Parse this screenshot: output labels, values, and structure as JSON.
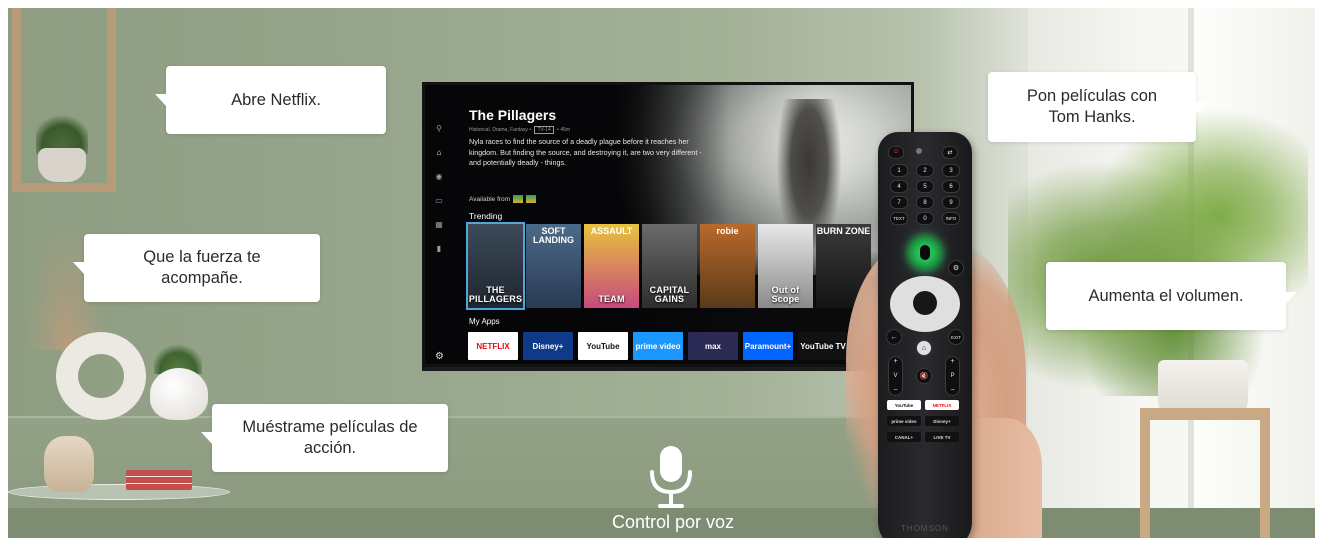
{
  "bubbles": {
    "netflix": "Abre Netflix.",
    "force": "Que la fuerza te acompañe.",
    "action": "Muéstrame películas de acción.",
    "hanks": "Pon películas con Tom Hanks.",
    "volume": "Aumenta el volumen."
  },
  "caption": "Control por voz",
  "tv": {
    "title": "The Pillagers",
    "meta": "Historical, Drama, Fantasy",
    "rating": "TV-14",
    "duration": "45m",
    "description": "Nyla races to find the source of a deadly plague before it reaches her kingdom. But finding the source, and destroying it, are two very different - and potentially deadly - things.",
    "available_from": "Available from",
    "trending_label": "Trending",
    "myapps_label": "My Apps",
    "trending": [
      {
        "top": "",
        "title": "THE PILLAGERS",
        "colors": [
          "#3c4a58",
          "#1e2630"
        ],
        "selected": true
      },
      {
        "top": "SOFT LANDING",
        "title": "",
        "colors": [
          "#4b6a8a",
          "#2a3a52"
        ]
      },
      {
        "top": "ASSAULT",
        "title": "TEAM",
        "colors": [
          "#e8c33c",
          "#c74a7e"
        ]
      },
      {
        "top": "",
        "title": "CAPITAL GAINS",
        "colors": [
          "#6a6a6a",
          "#2e2e2e"
        ]
      },
      {
        "top": "robie",
        "title": "",
        "colors": [
          "#b96a2a",
          "#5a3a1a"
        ]
      },
      {
        "top": "",
        "title": "Out of Scope",
        "colors": [
          "#e8e8e8",
          "#8a8a8a"
        ]
      },
      {
        "top": "BURN ZONE",
        "title": "",
        "colors": [
          "#3a3a3a",
          "#141414"
        ]
      }
    ],
    "apps": [
      {
        "label": "NETFLIX",
        "bg": "#ffffff",
        "fg": "#e50914"
      },
      {
        "label": "Disney+",
        "bg": "#0f3a8a",
        "fg": "#ffffff"
      },
      {
        "label": "YouTube",
        "bg": "#ffffff",
        "fg": "#111111"
      },
      {
        "label": "prime video",
        "bg": "#1a98ff",
        "fg": "#ffffff"
      },
      {
        "label": "max",
        "bg": "#2a2a55",
        "fg": "#ffffff"
      },
      {
        "label": "Paramount+",
        "bg": "#0064ff",
        "fg": "#ffffff"
      },
      {
        "label": "YouTube TV",
        "bg": "#111111",
        "fg": "#ffffff"
      }
    ]
  },
  "remote": {
    "keys": [
      "1",
      "2",
      "3",
      "4",
      "5",
      "6",
      "7",
      "8",
      "9"
    ],
    "text_key": "TEXT",
    "zero_key": "0",
    "info_key": "INFO",
    "exit_key": "EXIT",
    "vol_label": "V",
    "ch_label": "P",
    "apps": [
      {
        "label": "YouTube",
        "bg": "#ffffff",
        "fg": "#111"
      },
      {
        "label": "NETFLIX",
        "bg": "#ffffff",
        "fg": "#e50914"
      },
      {
        "label": "prime video",
        "bg": "#111111",
        "fg": "#dddddd"
      },
      {
        "label": "Disney+",
        "bg": "#111111",
        "fg": "#dddddd"
      },
      {
        "label": "CANAL+",
        "bg": "#111111",
        "fg": "#dddddd"
      },
      {
        "label": "LIVE TV",
        "bg": "#111111",
        "fg": "#dddddd"
      }
    ],
    "brand": "THOMSON"
  },
  "colors": {
    "wall": "#97a68c",
    "mic_green": "#2cdc63",
    "selection": "#4fa7d8"
  }
}
